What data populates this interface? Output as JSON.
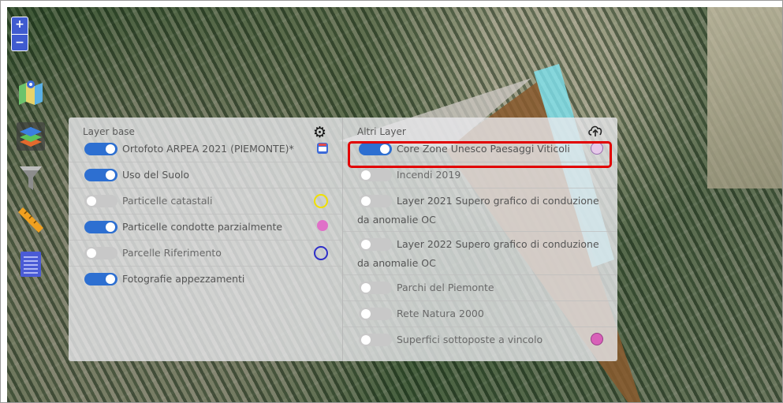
{
  "zoom": {
    "in_label": "+",
    "out_label": "−"
  },
  "toolbar": [
    {
      "name": "map-icon"
    },
    {
      "name": "layers-icon",
      "selected": true
    },
    {
      "name": "filter-icon"
    },
    {
      "name": "ruler-icon"
    },
    {
      "name": "list-icon"
    }
  ],
  "layers_panel": {
    "base": {
      "title": "Layer base",
      "settings_icon": "gear-icon",
      "items": [
        {
          "label": "Ortofoto ARPEA 2021 (PIEMONTE)*",
          "on": true,
          "symbol": "calendar-icon"
        },
        {
          "label": "Uso del Suolo",
          "on": true
        },
        {
          "label": "Particelle catastali",
          "on": false,
          "symbol_color": "#f0e000"
        },
        {
          "label": "Particelle condotte parzialmente",
          "on": true,
          "symbol_color": "#e070c8"
        },
        {
          "label": "Parcelle Riferimento",
          "on": false,
          "symbol_color": "#2e2ec8"
        },
        {
          "label": "Fotografie appezzamenti",
          "on": true
        }
      ]
    },
    "other": {
      "title": "Altri Layer",
      "upload_icon": "cloud-upload-icon",
      "items": [
        {
          "label": "Core Zone Unesco Paesaggi Viticoli",
          "on": true,
          "symbol_color": "#d48ad8",
          "highlighted": true
        },
        {
          "label": "Incendi 2019",
          "on": false
        },
        {
          "label_line1": "Layer 2021 Supero grafico di conduzione",
          "label_line2": "da anomalie OC",
          "on": false
        },
        {
          "label_line1": "Layer 2022 Supero grafico di conduzione",
          "label_line2": "da anomalie OC",
          "on": false
        },
        {
          "label": "Parchi del Piemonte",
          "on": false
        },
        {
          "label": "Rete Natura 2000",
          "on": false
        },
        {
          "label": "Superfici sottoposte a vincolo",
          "on": false,
          "symbol_color": "#d860b8"
        }
      ]
    }
  },
  "colors": {
    "toggle_on": "#2d6fd1",
    "toggle_off": "#c8c8c8",
    "highlight": "#e20000",
    "overlay_brown": "#8a5a2e",
    "overlay_cyan": "#7fe3f0"
  }
}
